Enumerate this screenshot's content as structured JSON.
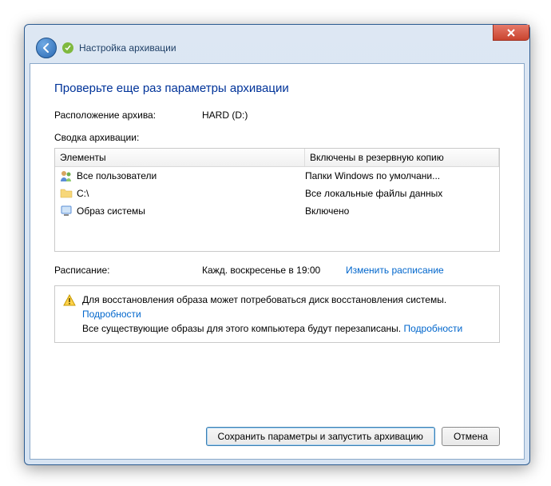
{
  "header": {
    "title": "Настройка архивации"
  },
  "heading": "Проверьте еще раз параметры архивации",
  "location": {
    "label": "Расположение архива:",
    "value": "HARD (D:)"
  },
  "summary": {
    "label": "Сводка архивации:",
    "columns": {
      "c1": "Элементы",
      "c2": "Включены в резервную копию"
    },
    "rows": [
      {
        "icon": "users-icon",
        "name": "Все пользователи",
        "included": "Папки Windows по умолчани..."
      },
      {
        "icon": "folder-icon",
        "name": "C:\\",
        "included": "Все локальные файлы данных"
      },
      {
        "icon": "system-image-icon",
        "name": "Образ системы",
        "included": "Включено"
      }
    ]
  },
  "schedule": {
    "label": "Расписание:",
    "value": "Кажд. воскресенье в 19:00",
    "change_link": "Изменить расписание"
  },
  "warning": {
    "line1": "Для восстановления образа может потребоваться диск восстановления системы.",
    "details1": "Подробности",
    "line2": "Все существующие образы для этого компьютера будут перезаписаны.",
    "details2": "Подробности"
  },
  "buttons": {
    "save": "Сохранить параметры и запустить архивацию",
    "cancel": "Отмена"
  }
}
